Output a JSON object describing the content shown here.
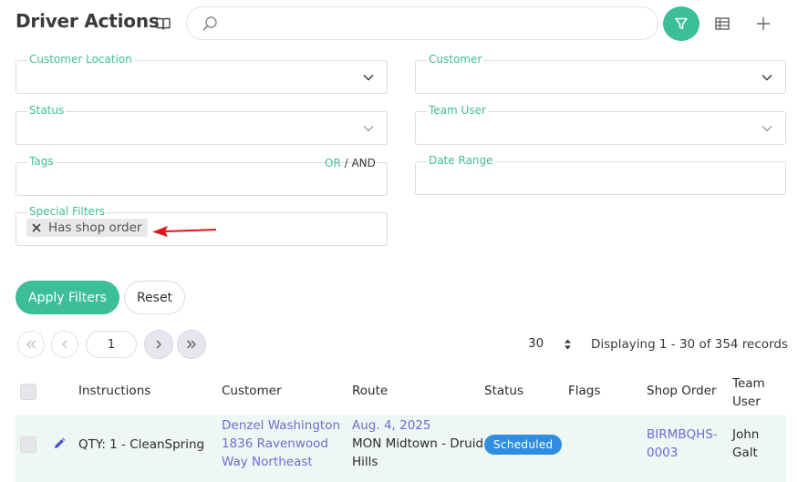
{
  "header": {
    "title": "Driver Actions",
    "search_placeholder": ""
  },
  "filters": {
    "customer_location": {
      "label": "Customer Location",
      "value": ""
    },
    "customer": {
      "label": "Customer",
      "value": ""
    },
    "status": {
      "label": "Status",
      "value": ""
    },
    "team_user": {
      "label": "Team User",
      "value": ""
    },
    "tags": {
      "label": "Tags",
      "or_label": "OR",
      "separator": " / ",
      "and_label": "AND"
    },
    "date_range": {
      "label": "Date Range",
      "value": ""
    },
    "special_filters": {
      "label": "Special Filters",
      "chip": "Has shop order"
    }
  },
  "actions": {
    "apply_label": "Apply Filters",
    "reset_label": "Reset"
  },
  "pagination": {
    "page": "1",
    "per_page": "30",
    "display_text": "Displaying 1 - 30 of 354 records"
  },
  "table": {
    "headers": {
      "instructions": "Instructions",
      "customer": "Customer",
      "route": "Route",
      "status": "Status",
      "flags": "Flags",
      "shop_order": "Shop Order",
      "team_user_line1": "Team",
      "team_user_line2": "User"
    },
    "rows": [
      {
        "instructions": "QTY: 1 - CleanSpring",
        "customer_line1": "Denzel Washington",
        "customer_line2": "1836 Ravenwood",
        "customer_line3": "Way Northeast",
        "route_date": "Aug. 4, 2025",
        "route_line1": "MON Midtown - Druid",
        "route_line2": "Hills",
        "status": "Scheduled",
        "flags": "",
        "shop_order_line1": "BIRMBQHS-",
        "shop_order_line2": "0003",
        "team_user_line1": "John",
        "team_user_line2": "Galt"
      }
    ]
  },
  "colors": {
    "accent": "#3cbf98",
    "link": "#6a6fd0",
    "badge": "#2f8ee0",
    "annotation_arrow": "#e0161b"
  }
}
